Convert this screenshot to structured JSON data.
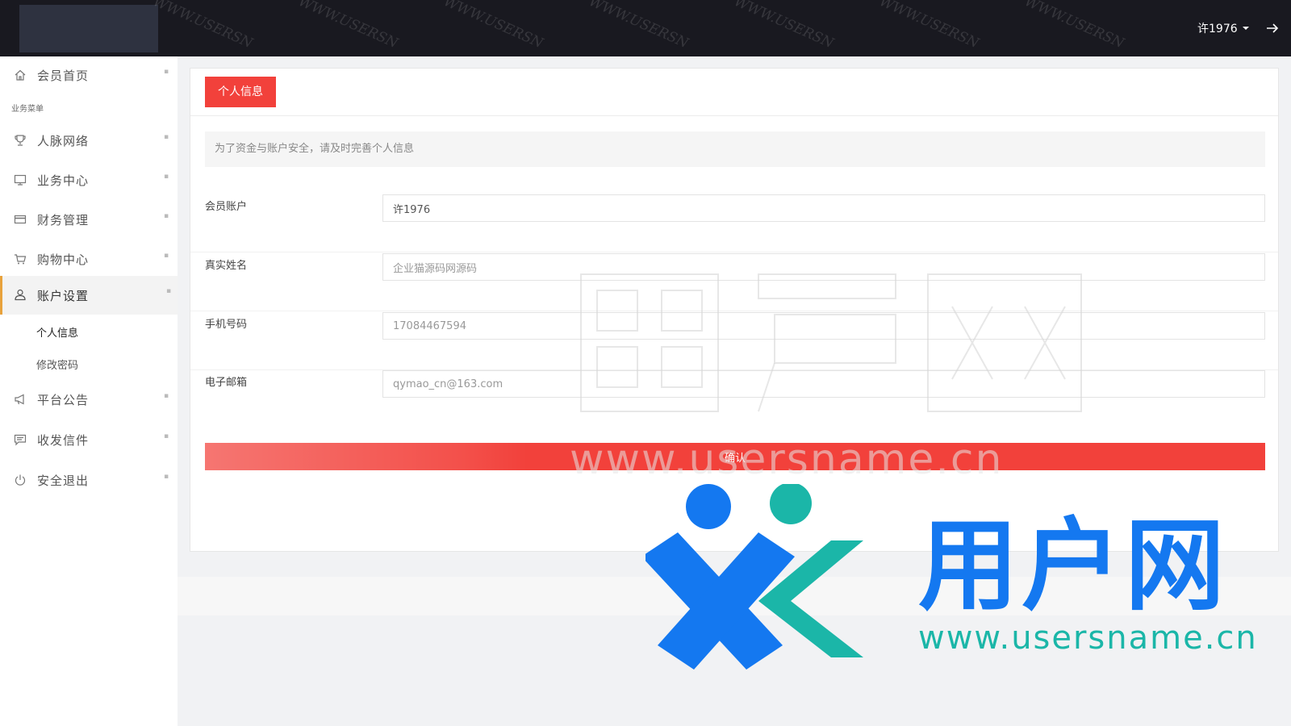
{
  "header": {
    "username": "许1976",
    "watermark_text": "WWW.USERSN",
    "logout_icon": "arrow-right-icon"
  },
  "sidebar": {
    "home": {
      "label": "会员首页",
      "icon": "home-icon"
    },
    "section_label": "业务菜单",
    "items": [
      {
        "label": "人脉网络",
        "icon": "trophy-icon"
      },
      {
        "label": "业务中心",
        "icon": "monitor-icon"
      },
      {
        "label": "财务管理",
        "icon": "card-icon"
      },
      {
        "label": "购物中心",
        "icon": "cart-icon"
      },
      {
        "label": "账户设置",
        "icon": "user-icon",
        "active": true
      },
      {
        "label": "平台公告",
        "icon": "megaphone-icon"
      },
      {
        "label": "收发信件",
        "icon": "message-icon"
      },
      {
        "label": "安全退出",
        "icon": "power-icon"
      }
    ],
    "sub_items": [
      {
        "label": "个人信息",
        "current": true
      },
      {
        "label": "修改密码"
      }
    ]
  },
  "panel": {
    "tab_label": "个人信息",
    "notice": "为了资金与账户安全，请及时完善个人信息",
    "fields": [
      {
        "label": "会员账户",
        "value": "许1976"
      },
      {
        "label": "真实姓名",
        "value": "企业猫源码网源码"
      },
      {
        "label": "手机号码",
        "value": "17084467594"
      },
      {
        "label": "电子邮箱",
        "value": "qymao_cn@163.com"
      }
    ],
    "confirm_label": "确认"
  },
  "watermark": {
    "brand_text": "用户网",
    "brand_url": "www.usersname.cn",
    "faint_url": "www.usersname.cn",
    "colors": {
      "brand_blue": "#1478f0",
      "brand_teal": "#1bb6a8",
      "accent_red": "#f2413b",
      "active_bar": "#e8a23c"
    }
  }
}
